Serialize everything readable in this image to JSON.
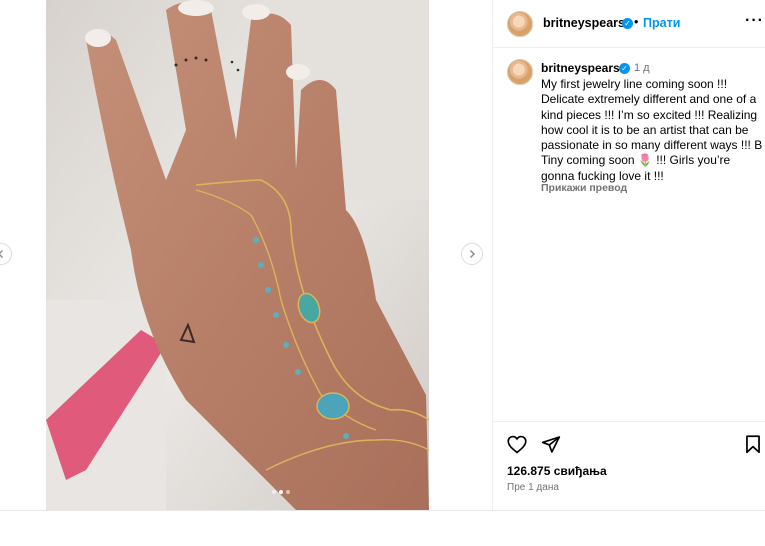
{
  "post": {
    "username": "britneyspears",
    "follow_separator": "•",
    "follow_label": "Прати",
    "more_label": "···",
    "verified_glyph": "✓"
  },
  "caption": {
    "username": "britneyspears",
    "time": "1 д",
    "text": "My first jewelry line coming soon !!! Delicate extremely different and one of a kind pieces !!! I’m so excited !!! Realizing how cool it is to be an artist that can be passionate in so many different ways !!! B Tiny coming soon 🌷 !!! Girls you’re gonna fucking love it !!!",
    "translate_label": "Прикажи превод"
  },
  "engagement": {
    "likes": "126.875 свиђања",
    "time_ago": "Пре 1 дана"
  },
  "carousel": {
    "slide_count": 3,
    "active_index": 1
  },
  "icons": {
    "like": "heart-icon",
    "share": "send-icon",
    "save": "bookmark-icon",
    "prev": "chevron-left-icon",
    "next": "chevron-right-icon"
  },
  "colors": {
    "accent": "#0095f6",
    "secondary_text": "#737373",
    "border": "#efefef"
  }
}
